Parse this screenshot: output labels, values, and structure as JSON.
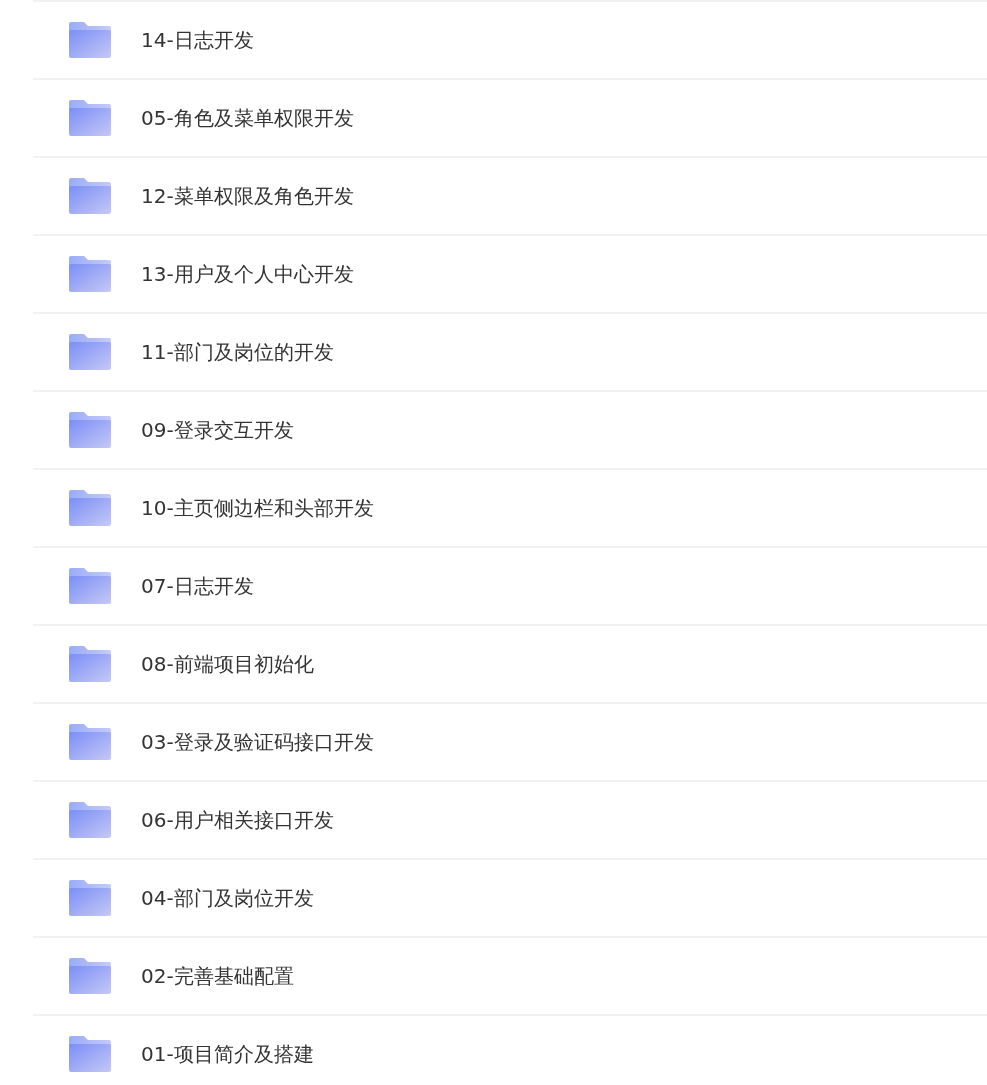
{
  "folders": [
    {
      "name": "14-日志开发"
    },
    {
      "name": "05-角色及菜单权限开发"
    },
    {
      "name": "12-菜单权限及角色开发"
    },
    {
      "name": "13-用户及个人中心开发"
    },
    {
      "name": "11-部门及岗位的开发"
    },
    {
      "name": "09-登录交互开发"
    },
    {
      "name": "10-主页侧边栏和头部开发"
    },
    {
      "name": "07-日志开发"
    },
    {
      "name": "08-前端项目初始化"
    },
    {
      "name": "03-登录及验证码接口开发"
    },
    {
      "name": "06-用户相关接口开发"
    },
    {
      "name": "04-部门及岗位开发"
    },
    {
      "name": "02-完善基础配置"
    },
    {
      "name": "01-项目简介及搭建"
    }
  ]
}
